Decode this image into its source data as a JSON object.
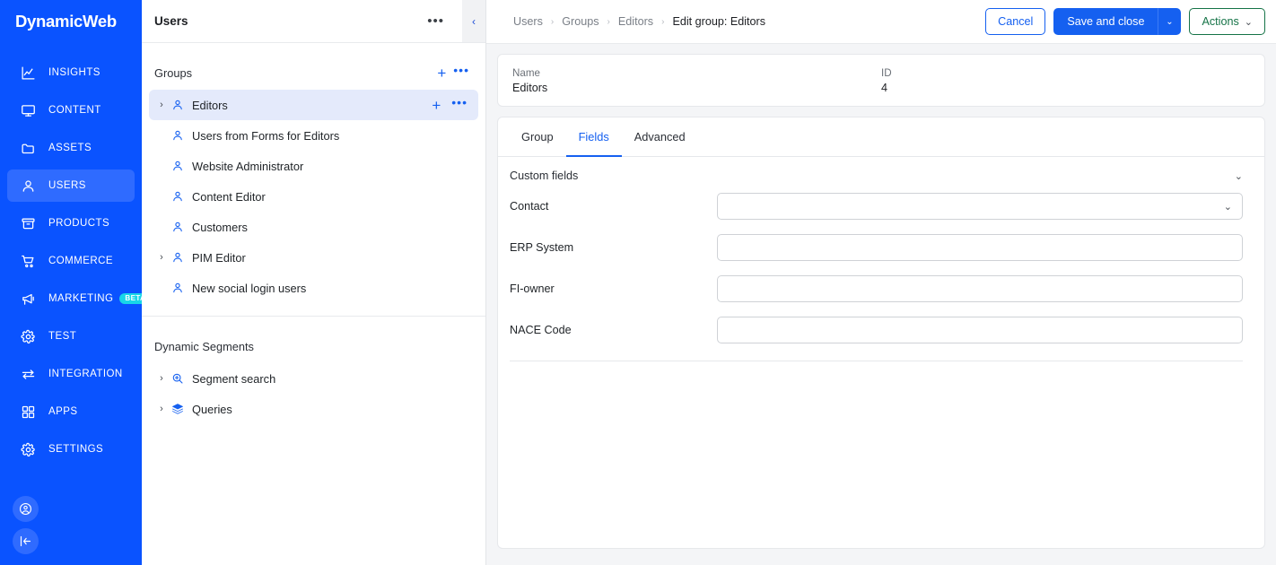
{
  "brand": {
    "name": "DynamicWeb",
    "accent": "#0a53ff",
    "beta_color": "#18d6e8"
  },
  "nav": {
    "items": [
      {
        "label": "INSIGHTS",
        "icon": "chart-icon",
        "active": false
      },
      {
        "label": "CONTENT",
        "icon": "monitor-icon",
        "active": false
      },
      {
        "label": "ASSETS",
        "icon": "folder-icon",
        "active": false
      },
      {
        "label": "USERS",
        "icon": "user-icon",
        "active": true
      },
      {
        "label": "PRODUCTS",
        "icon": "box-icon",
        "active": false
      },
      {
        "label": "COMMERCE",
        "icon": "cart-icon",
        "active": false
      },
      {
        "label": "MARKETING",
        "icon": "megaphone-icon",
        "active": false,
        "badge": "BETA"
      },
      {
        "label": "TEST",
        "icon": "gear-icon",
        "active": false
      },
      {
        "label": "INTEGRATION",
        "icon": "exchange-icon",
        "active": false
      },
      {
        "label": "APPS",
        "icon": "grid-icon",
        "active": false
      },
      {
        "label": "SETTINGS",
        "icon": "gear-icon",
        "active": false
      }
    ],
    "bottom": [
      {
        "icon": "account-circle-icon"
      },
      {
        "icon": "collapse-left-icon"
      }
    ]
  },
  "panel": {
    "title": "Users",
    "more_label": "•••",
    "collapse_label": "‹",
    "groups_section": {
      "title": "Groups",
      "add_label": "+",
      "more_label": "•••",
      "items": [
        {
          "label": "Editors",
          "icon": "user-group-icon",
          "caret": "›",
          "selected": true,
          "has_actions": true
        },
        {
          "label": "Users from Forms for Editors",
          "icon": "user-group-icon",
          "caret": "",
          "selected": false,
          "has_actions": false
        },
        {
          "label": "Website Administrator",
          "icon": "user-group-icon",
          "caret": "",
          "selected": false,
          "has_actions": false
        },
        {
          "label": "Content Editor",
          "icon": "user-group-icon",
          "caret": "",
          "selected": false,
          "has_actions": false
        },
        {
          "label": "Customers",
          "icon": "user-group-icon",
          "caret": "",
          "selected": false,
          "has_actions": false
        },
        {
          "label": "PIM Editor",
          "icon": "user-group-icon",
          "caret": "›",
          "selected": false,
          "has_actions": false
        },
        {
          "label": "New social login users",
          "icon": "user-group-icon",
          "caret": "",
          "selected": false,
          "has_actions": false
        }
      ]
    },
    "segments_section": {
      "title": "Dynamic Segments",
      "items": [
        {
          "label": "Segment search",
          "icon": "search-zoom-icon",
          "caret": "›"
        },
        {
          "label": "Queries",
          "icon": "layers-icon",
          "caret": "›"
        }
      ]
    }
  },
  "topbar": {
    "breadcrumbs": [
      {
        "label": "Users",
        "current": false
      },
      {
        "label": "Groups",
        "current": false
      },
      {
        "label": "Editors",
        "current": false
      },
      {
        "label": "Edit group: Editors",
        "current": true
      }
    ],
    "separator": "›",
    "cancel_label": "Cancel",
    "save_label": "Save and close",
    "save_caret": "⌄",
    "actions_label": "Actions",
    "actions_caret": "⌄"
  },
  "info": {
    "name_label": "Name",
    "name_value": "Editors",
    "id_label": "ID",
    "id_value": "4"
  },
  "tabs": [
    {
      "label": "Group",
      "active": false
    },
    {
      "label": "Fields",
      "active": true
    },
    {
      "label": "Advanced",
      "active": false
    }
  ],
  "form": {
    "group_title": "Custom fields",
    "group_chevron": "⌄",
    "fields": [
      {
        "label": "Contact",
        "type": "select",
        "value": "",
        "chevron": "⌄"
      },
      {
        "label": "ERP System",
        "type": "text",
        "value": "",
        "placeholder": ""
      },
      {
        "label": "FI-owner",
        "type": "text",
        "value": "",
        "placeholder": ""
      },
      {
        "label": "NACE Code",
        "type": "text",
        "value": "",
        "placeholder": ""
      }
    ]
  }
}
